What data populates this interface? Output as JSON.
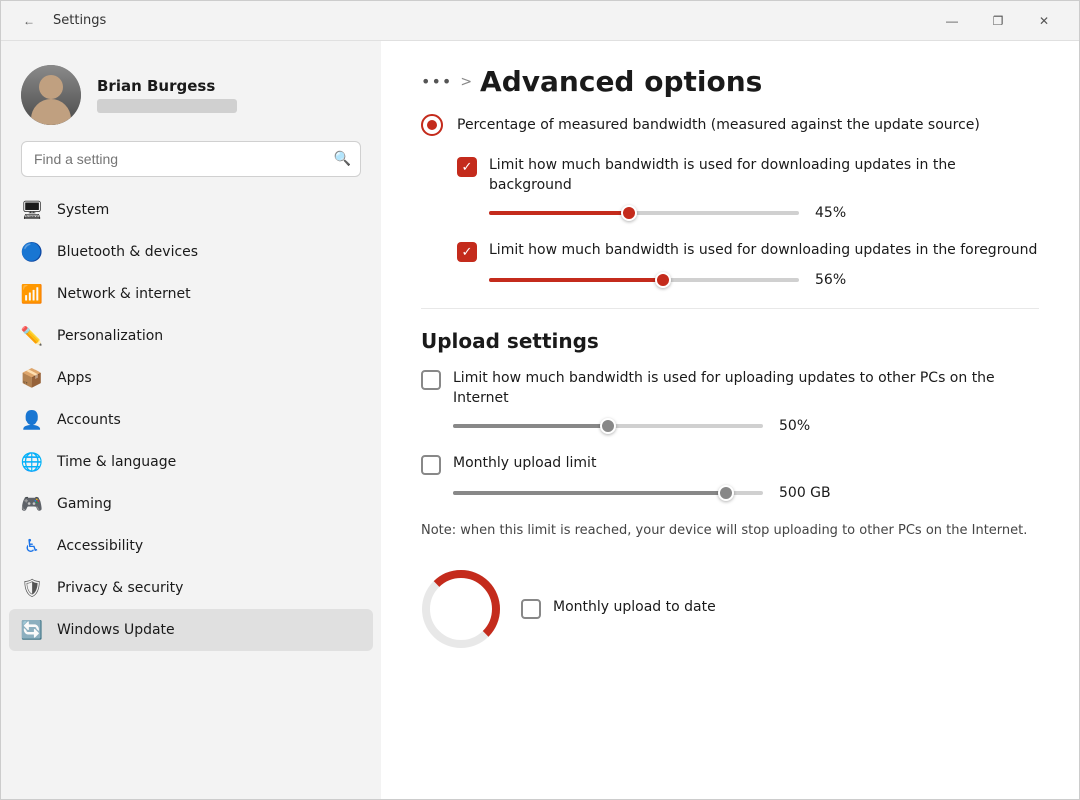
{
  "window": {
    "title": "Settings",
    "controls": {
      "minimize": "—",
      "maximize": "❐",
      "close": "✕"
    }
  },
  "sidebar": {
    "user": {
      "name": "Brian Burgess"
    },
    "search": {
      "placeholder": "Find a setting"
    },
    "nav": [
      {
        "id": "system",
        "label": "System",
        "icon": "🖥"
      },
      {
        "id": "bluetooth",
        "label": "Bluetooth & devices",
        "icon": "🔵"
      },
      {
        "id": "network",
        "label": "Network & internet",
        "icon": "📶"
      },
      {
        "id": "personalization",
        "label": "Personalization",
        "icon": "✏️"
      },
      {
        "id": "apps",
        "label": "Apps",
        "icon": "📦"
      },
      {
        "id": "accounts",
        "label": "Accounts",
        "icon": "👤"
      },
      {
        "id": "time",
        "label": "Time & language",
        "icon": "🌐"
      },
      {
        "id": "gaming",
        "label": "Gaming",
        "icon": "🎮"
      },
      {
        "id": "accessibility",
        "label": "Accessibility",
        "icon": "♿"
      },
      {
        "id": "privacy",
        "label": "Privacy & security",
        "icon": "🛡"
      },
      {
        "id": "windows_update",
        "label": "Windows Update",
        "icon": "🔄"
      }
    ]
  },
  "content": {
    "breadcrumb": {
      "dots": "•••",
      "separator": ">",
      "title": "Advanced options"
    },
    "radio_option": {
      "label": "Percentage of measured bandwidth (measured against the update source)"
    },
    "background_section": {
      "checkbox_label": "Limit how much bandwidth is used for downloading updates in the background",
      "slider_value": "45%",
      "slider_percent": 45
    },
    "foreground_section": {
      "checkbox_label": "Limit how much bandwidth is used for downloading updates in the foreground",
      "slider_value": "56%",
      "slider_percent": 56
    },
    "upload_section": {
      "title": "Upload settings",
      "upload_checkbox_label": "Limit how much bandwidth is used for uploading updates to other PCs on the Internet",
      "upload_slider_value": "50%",
      "upload_slider_percent": 50,
      "monthly_limit_label": "Monthly upload limit",
      "monthly_slider_value": "500 GB",
      "monthly_slider_percent": 90,
      "note": "Note: when this limit is reached, your device will stop uploading to other PCs on the Internet.",
      "monthly_to_date_label": "Monthly upload to date"
    }
  }
}
